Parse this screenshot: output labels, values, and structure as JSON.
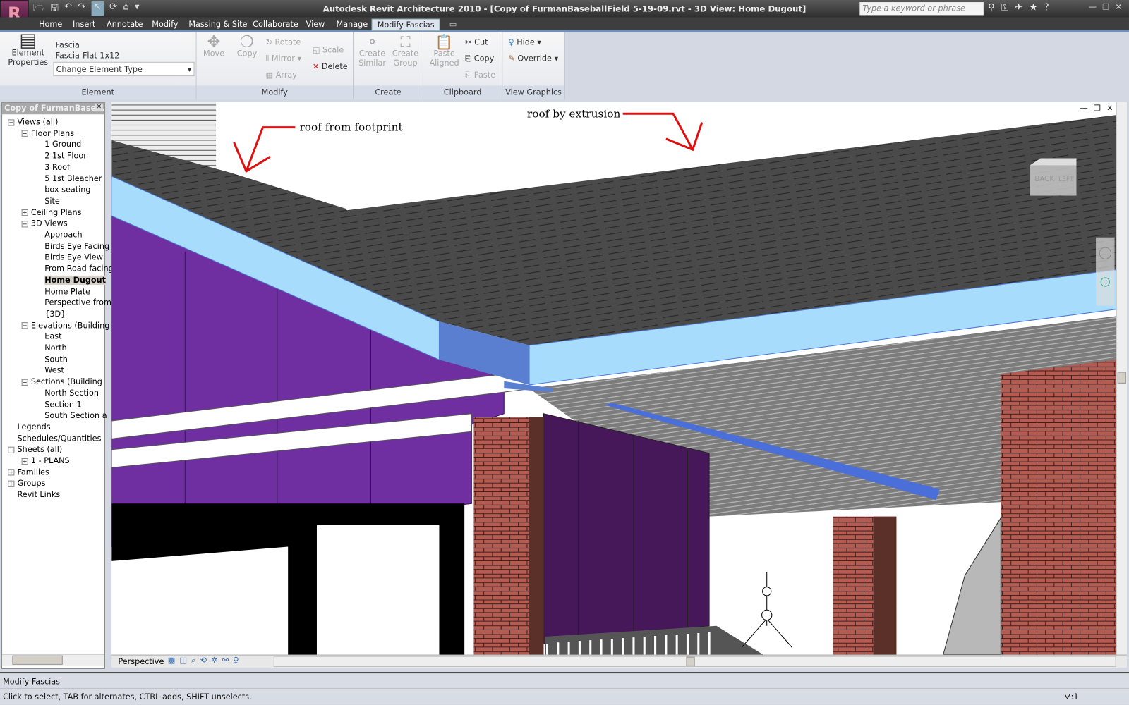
{
  "app": {
    "logo_letter": "R",
    "title": "Autodesk Revit Architecture 2010 - [Copy of FurmanBaseballField 5-19-09.rvt - 3D View: Home Dugout]",
    "search_placeholder": "Type a keyword or phrase"
  },
  "tabs": [
    "Home",
    "Insert",
    "Annotate",
    "Modify",
    "Massing & Site",
    "Collaborate",
    "View",
    "Manage",
    "Modify Fascias"
  ],
  "ribbon": {
    "element": {
      "label": "Element",
      "props": "Element Properties",
      "category": "Fascia",
      "type": "Fascia-Flat 1x12",
      "change_type": "Change Element Type"
    },
    "modify": {
      "label": "Modify",
      "move": "Move",
      "copy": "Copy",
      "rotate": "Rotate",
      "mirror": "Mirror",
      "array": "Array",
      "scale": "Scale",
      "delete": "Delete"
    },
    "create": {
      "label": "Create",
      "similar": "Create Similar",
      "group": "Create Group"
    },
    "clipboard": {
      "label": "Clipboard",
      "paste_aligned": "Paste Aligned",
      "cut": "Cut",
      "copy": "Copy",
      "paste": "Paste"
    },
    "view_graphics": {
      "label": "View Graphics",
      "hide": "Hide",
      "override": "Override"
    }
  },
  "browser": {
    "title": "Copy of FurmanBase...",
    "items": [
      {
        "t": "Views (all)",
        "l": 0,
        "b": "−"
      },
      {
        "t": "Floor Plans",
        "l": 1,
        "b": "−"
      },
      {
        "t": "1 Ground",
        "l": 2
      },
      {
        "t": "2 1st Floor",
        "l": 2
      },
      {
        "t": "3 Roof",
        "l": 2
      },
      {
        "t": "5 1st Bleacher",
        "l": 2
      },
      {
        "t": "box seating",
        "l": 2
      },
      {
        "t": "Site",
        "l": 2
      },
      {
        "t": "Ceiling Plans",
        "l": 1,
        "b": "+"
      },
      {
        "t": "3D Views",
        "l": 1,
        "b": "−"
      },
      {
        "t": "Approach",
        "l": 2
      },
      {
        "t": "Birds Eye Facing",
        "l": 2
      },
      {
        "t": "Birds Eye View",
        "l": 2
      },
      {
        "t": "From Road facing",
        "l": 2
      },
      {
        "t": "Home Dugout",
        "l": 2,
        "sel": true
      },
      {
        "t": "Home Plate",
        "l": 2
      },
      {
        "t": "Perspective from",
        "l": 2
      },
      {
        "t": "{3D}",
        "l": 2
      },
      {
        "t": "Elevations (Building",
        "l": 1,
        "b": "−"
      },
      {
        "t": "East",
        "l": 2
      },
      {
        "t": "North",
        "l": 2
      },
      {
        "t": "South",
        "l": 2
      },
      {
        "t": "West",
        "l": 2
      },
      {
        "t": "Sections (Building",
        "l": 1,
        "b": "−"
      },
      {
        "t": "North Section",
        "l": 2
      },
      {
        "t": "Section 1",
        "l": 2
      },
      {
        "t": "South Section a",
        "l": 2
      },
      {
        "t": "Legends",
        "l": 0
      },
      {
        "t": "Schedules/Quantities",
        "l": 0
      },
      {
        "t": "Sheets (all)",
        "l": 0,
        "b": "−"
      },
      {
        "t": "1 - PLANS",
        "l": 1,
        "b": "+"
      },
      {
        "t": "Families",
        "l": 0,
        "b": "+"
      },
      {
        "t": "Groups",
        "l": 0,
        "b": "+"
      },
      {
        "t": "Revit Links",
        "l": 0
      }
    ]
  },
  "viewport": {
    "annotation_left": "roof from footprint",
    "annotation_right": "roof by extrusion",
    "viewcube_back": "BACK",
    "viewcube_left": "LEFT",
    "view_mode": "Perspective"
  },
  "status": {
    "command": "Modify Fascias",
    "hint": "Click to select, TAB for alternates, CTRL adds, SHIFT unselects.",
    "filter": ":1"
  }
}
